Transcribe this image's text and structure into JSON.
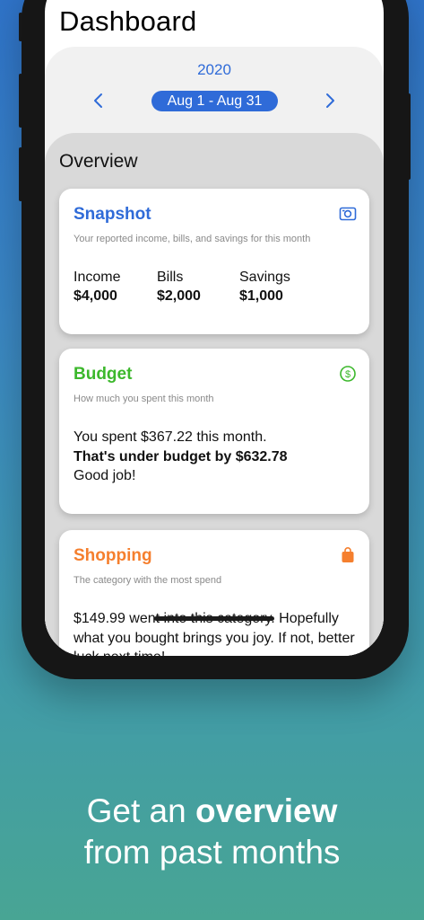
{
  "dashboard": {
    "title": "Dashboard",
    "year": "2020",
    "date_range": "Aug 1 - Aug 31",
    "accent_color": "#2f6bd8"
  },
  "overview": {
    "title": "Overview",
    "snapshot": {
      "title": "Snapshot",
      "subtitle": "Your reported income, bills, and savings for this month",
      "icon": "camera-icon",
      "color": "#2f6bd8",
      "stats": [
        {
          "label": "Income",
          "value": "$4,000"
        },
        {
          "label": "Bills",
          "value": "$2,000"
        },
        {
          "label": "Savings",
          "value": "$1,000"
        }
      ]
    },
    "budget": {
      "title": "Budget",
      "subtitle": "How much you spent this month",
      "icon": "dollar-circle-icon",
      "color": "#3cb82c",
      "line1": "You spent $367.22 this month.",
      "line2": "That's under budget by $632.78",
      "line3": "Good job!"
    },
    "shopping": {
      "title": "Shopping",
      "subtitle": "The category with the most spend",
      "icon": "shopping-bag-icon",
      "color": "#f57f2e",
      "text": "$149.99 went into this category. Hopefully what you bought brings you joy. If not, better luck next time!"
    }
  },
  "caption": {
    "prefix": "Get an ",
    "bold": "overview",
    "line2": "from past months"
  }
}
